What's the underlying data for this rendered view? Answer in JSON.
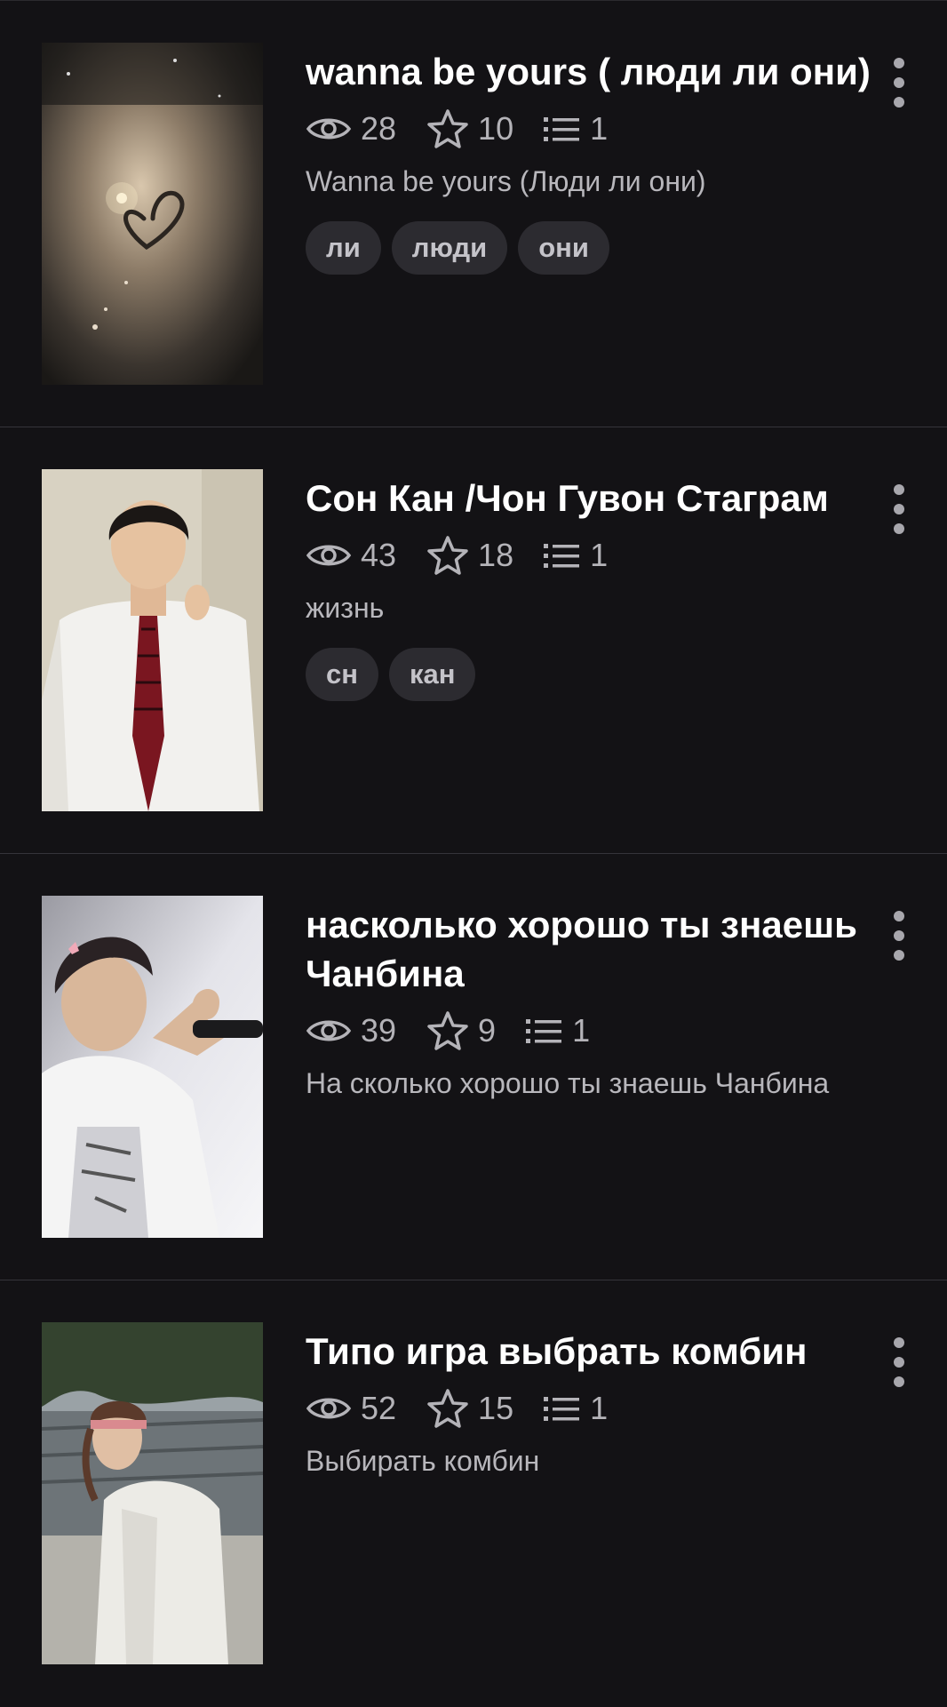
{
  "stories": [
    {
      "title": "wanna be yours ( люди ли они)",
      "views": "28",
      "votes": "10",
      "parts": "1",
      "description": "Wanna be yours (Люди ли они)",
      "tags": [
        "ли",
        "люди",
        "они"
      ],
      "cover_icon": "foggy-window-heart-image"
    },
    {
      "title": "Сон Кан /Чон Гувон Стаграм",
      "views": "43",
      "votes": "18",
      "parts": "1",
      "description": "жизнь",
      "tags": [
        "сн",
        "кан"
      ],
      "cover_icon": "person-white-shirt-tie-image"
    },
    {
      "title": "насколько хорошо ты знаешь Чанбина",
      "views": "39",
      "votes": "9",
      "parts": "1",
      "description": "На сколько хорошо ты знаешь Чанбина",
      "tags": [],
      "cover_icon": "performer-heart-hands-image"
    },
    {
      "title": "Типо игра выбрать комбин",
      "views": "52",
      "votes": "15",
      "parts": "1",
      "description": "Выбирать комбин",
      "tags": [],
      "cover_icon": "person-white-jacket-outdoor-image"
    }
  ],
  "colors": {
    "background": "#131215",
    "title": "#ffffff",
    "meta": "#b4b3b8",
    "tag_bg": "#2c2b30",
    "divider": "#35343a"
  }
}
